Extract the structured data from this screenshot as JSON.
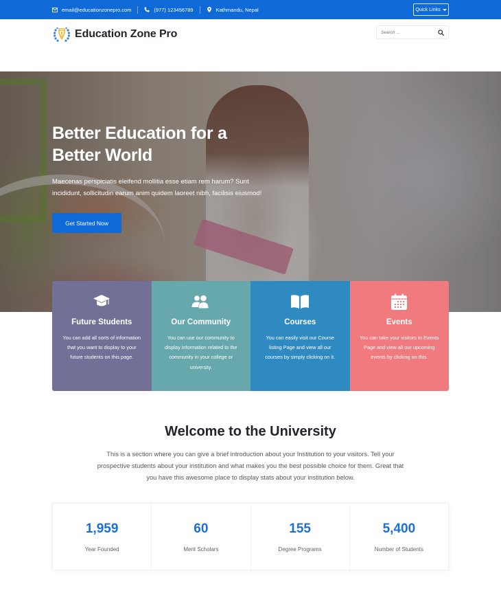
{
  "topbar": {
    "email": "email@educationzonepro.com",
    "phone": "(977) 123456789",
    "location": "Kathmandu, Nepal",
    "quick_links_label": "Quick Links",
    "background_color": "#0f6ad8"
  },
  "header": {
    "site_name": "Education Zone Pro",
    "search_placeholder": "Search ..."
  },
  "hero": {
    "title_line1": "Better Education for a",
    "title_line2": "Better World",
    "text": "Maecenas perspiciatis eleifend mollitia esse etiam rem harum? Sunt incididunt, sollicitudin earum anim quidem laoreet nibh, facilisis eiusmod!",
    "button_label": "Get Started Now"
  },
  "features": [
    {
      "icon": "graduation-cap-icon",
      "title": "Future Students",
      "text": "You can add all sorts of information that you want to display to your future students on this page.",
      "color": "#717096"
    },
    {
      "icon": "users-icon",
      "title": "Our Community",
      "text": "You can use our community to display information related to the community in your college or university.",
      "color": "#67a8ad"
    },
    {
      "icon": "book-open-icon",
      "title": "Courses",
      "text": "You can easily visit our Course listing Page and view all our courses by simply clicking on it.",
      "color": "#2f8ac1"
    },
    {
      "icon": "calendar-icon",
      "title": "Events",
      "text": "You can take your visitors to Events Page and view all our upcoming events by clicking on this.",
      "color": "#f07a7d"
    }
  ],
  "welcome": {
    "title": "Welcome to the University",
    "text": "This is a section where you can give a brief introduction about your Institution to your visitors. Tell your prospective students about your institution and what makes you the best possible choice for them. Great that you have this awesome place to display stats about your institution below."
  },
  "stats": [
    {
      "value": "1,959",
      "label": "Year Founded"
    },
    {
      "value": "60",
      "label": "Merit Scholars"
    },
    {
      "value": "155",
      "label": "Degree Programs"
    },
    {
      "value": "5,400",
      "label": "Number of Students"
    }
  ]
}
